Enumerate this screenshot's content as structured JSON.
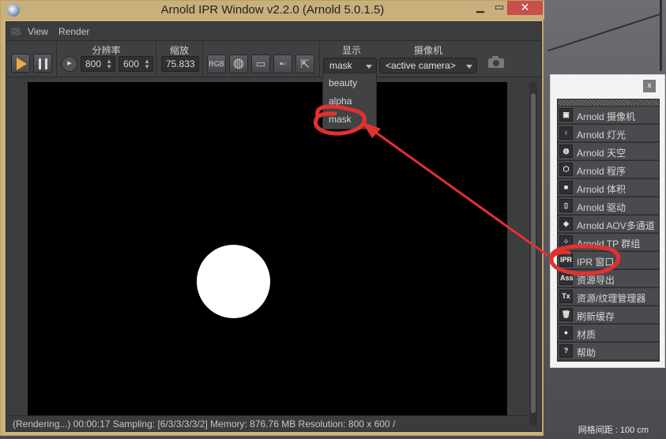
{
  "window": {
    "title": "Arnold IPR Window v2.2.0 (Arnold 5.0.1.5)",
    "minimize": "▁",
    "maximize": "▭",
    "close": "✕"
  },
  "menu": [
    "View",
    "Render"
  ],
  "toolbar": {
    "resolution_label": "分辨率",
    "width": "800",
    "height": "600",
    "zoom_label": "缩放",
    "zoom": "75.833",
    "rgb_label": "RGB",
    "display_label": "显示",
    "display_value": "mask",
    "camera_label": "摄像机",
    "camera_value": "<active camera>"
  },
  "display_options": [
    "beauty",
    "alpha",
    "mask"
  ],
  "status": "(Rendering...)  00:00:17  Sampling: [6/3/3/3/3/2]  Memory: 876.76 MB  Resolution: 800 x 600 /",
  "panel": {
    "close": "x",
    "items": [
      {
        "icon": "camera-icon",
        "glyph": "▣",
        "label": "Arnold 摄像机"
      },
      {
        "icon": "light-icon",
        "glyph": "♀",
        "label": "Arnold 灯光"
      },
      {
        "icon": "sky-icon",
        "glyph": "◍",
        "label": "Arnold 天空"
      },
      {
        "icon": "procedural-icon",
        "glyph": "⬡",
        "label": "Arnold 程序"
      },
      {
        "icon": "volume-icon",
        "glyph": "■",
        "label": "Arnold 体积"
      },
      {
        "icon": "driver-icon",
        "glyph": "▯",
        "label": "Arnold 驱动"
      },
      {
        "icon": "aov-icon",
        "glyph": "◈",
        "label": "Arnold AOV多通道"
      },
      {
        "icon": "tp-group-icon",
        "glyph": "⁘",
        "label": "Arnold TP 群组"
      },
      {
        "icon": "ipr-icon",
        "glyph": "IPR",
        "label": "IPR 窗口"
      },
      {
        "icon": "ass-icon",
        "glyph": "Ass",
        "label": "资源导出"
      },
      {
        "icon": "tx-icon",
        "glyph": "Tx",
        "label": "资源/纹理管理器"
      },
      {
        "icon": "trash-icon",
        "glyph": "🗑",
        "label": "刷新缓存"
      },
      {
        "icon": "material-icon",
        "glyph": "●",
        "label": "材质"
      },
      {
        "icon": "help-icon",
        "glyph": "?",
        "label": "帮助"
      }
    ]
  },
  "viewport_grid": "网格间距 : 100 cm",
  "colors": {
    "titlebar": "#c8b07c",
    "accent_play": "#f3a64a",
    "annotation": "#e53030"
  }
}
